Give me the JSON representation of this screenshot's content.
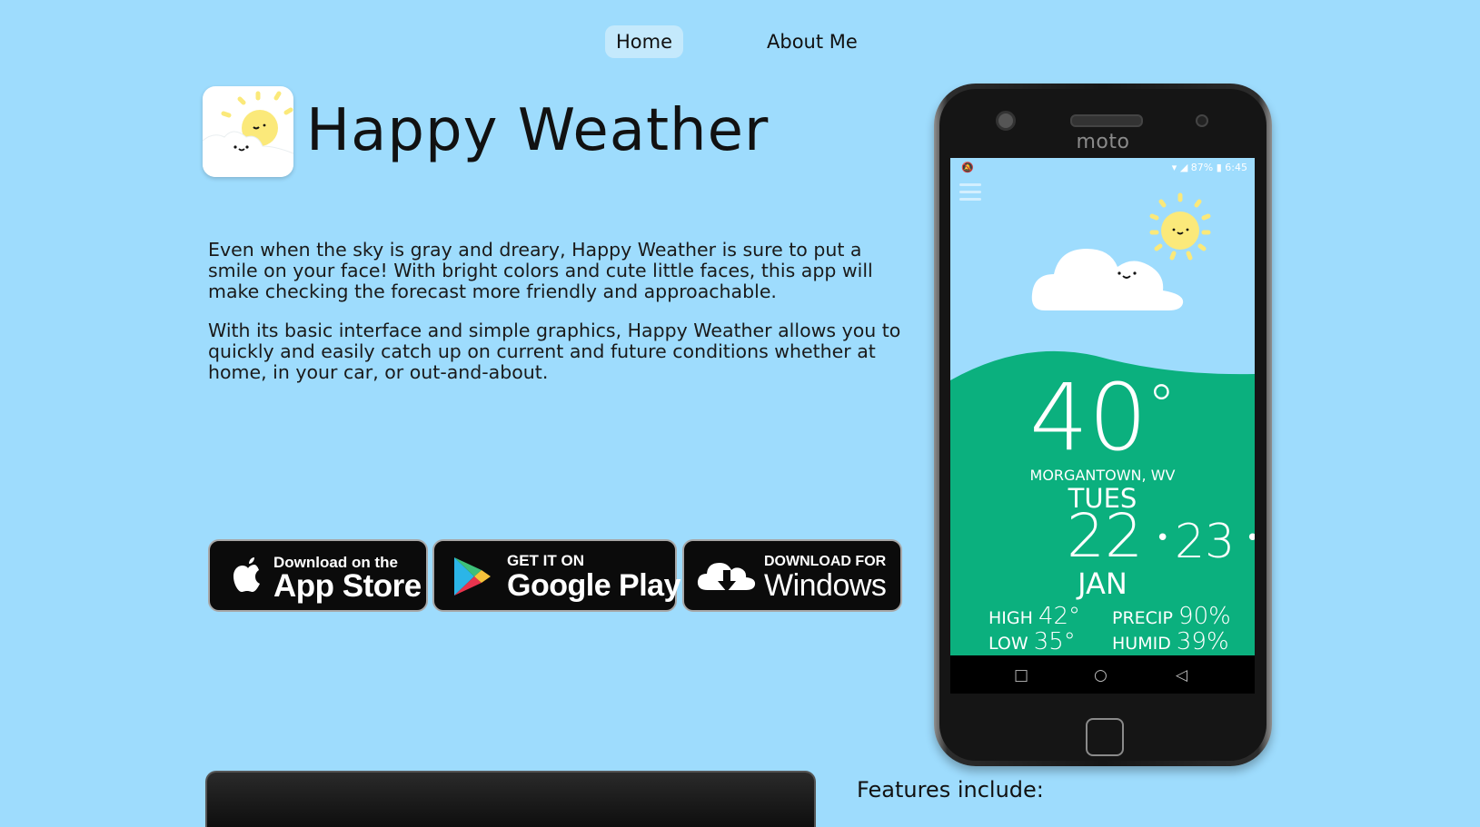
{
  "nav": {
    "home": "Home",
    "about": "About Me"
  },
  "app": {
    "title": "Happy Weather"
  },
  "intro": {
    "p1": "Even when the sky is gray and dreary, Happy Weather is sure to put a smile on your face! With bright colors and cute little faces, this app will make checking the forecast more friendly and approachable.",
    "p2": "With its basic interface and simple graphics, Happy Weather allows you to quickly and easily catch up on current and future conditions whether at home, in your car, or out-and-about."
  },
  "stores": {
    "apple": {
      "small": "Download on the",
      "big": "App Store"
    },
    "google": {
      "small": "GET IT ON",
      "big": "Google Play"
    },
    "windows": {
      "small": "DOWNLOAD FOR",
      "big": "Windows"
    }
  },
  "phone": {
    "brand": "moto",
    "status": {
      "battery": "87%",
      "time": "6:45"
    },
    "weather": {
      "temp": "40",
      "deg": "°",
      "location": "MORGANTOWN, WV",
      "day": "TUES",
      "date": "22",
      "next_date": "23",
      "month": "JAN",
      "high_label": "HIGH",
      "high": "42°",
      "low_label": "LOW",
      "low": "35°",
      "precip_label": "PRECIP",
      "precip": "90%",
      "humid_label": "HUMID",
      "humid": "39%"
    }
  },
  "features": {
    "heading": "Features include:"
  },
  "colors": {
    "background": "#9edcfd",
    "green": "#0bb07e",
    "sun": "#fbe97a"
  }
}
